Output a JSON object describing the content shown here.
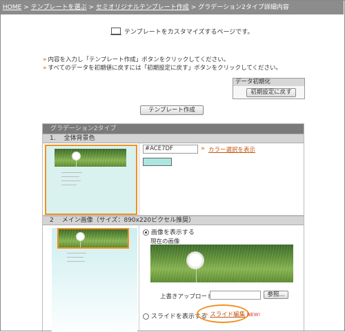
{
  "breadcrumb": {
    "home": "HOME",
    "sep": ">",
    "choose": "テンプレートを選ぶ",
    "semi": "セミオリジナルテンプレート作成",
    "current": "グラデーション2タイプ詳細内容"
  },
  "intro_text": "テンプレートをカスタマイズするページです。",
  "notes": {
    "arrow": "»",
    "line1": "内容を入力し「テンプレート作成」ボタンをクリックしてください。",
    "line2": "すべてのデータを初期値に戻すには「初期設定に戻す」ボタンをクリックしてください。"
  },
  "reset": {
    "heading": "データ初期化",
    "button": "初期設定に戻す"
  },
  "create_button": "テンプレート作成",
  "panel": {
    "title": "グラデーション2タイプ",
    "sections": [
      {
        "num": "1.",
        "label": "全体背景色"
      },
      {
        "num": "2",
        "label": "メイン画像（サイズ：890x220ピクセル推奨）"
      }
    ]
  },
  "bg_color": {
    "value": "#ACE7DF",
    "swatch": "#ACE7DF",
    "link_arrow": "»",
    "link": "カラー選択を表示"
  },
  "main_image": {
    "show_image": "画像を表示する",
    "current_label": "現在の画像",
    "upload_label": "上書きアップロード",
    "browse_button": "参照...",
    "show_slide": "スライドを表示する",
    "slide_arrow": "»",
    "slide_link": "スライド編集",
    "new_badge": "NEW!"
  },
  "colors": {
    "accent": "#F0901E",
    "header": "#8C8C8C",
    "link": "#C4520A"
  }
}
